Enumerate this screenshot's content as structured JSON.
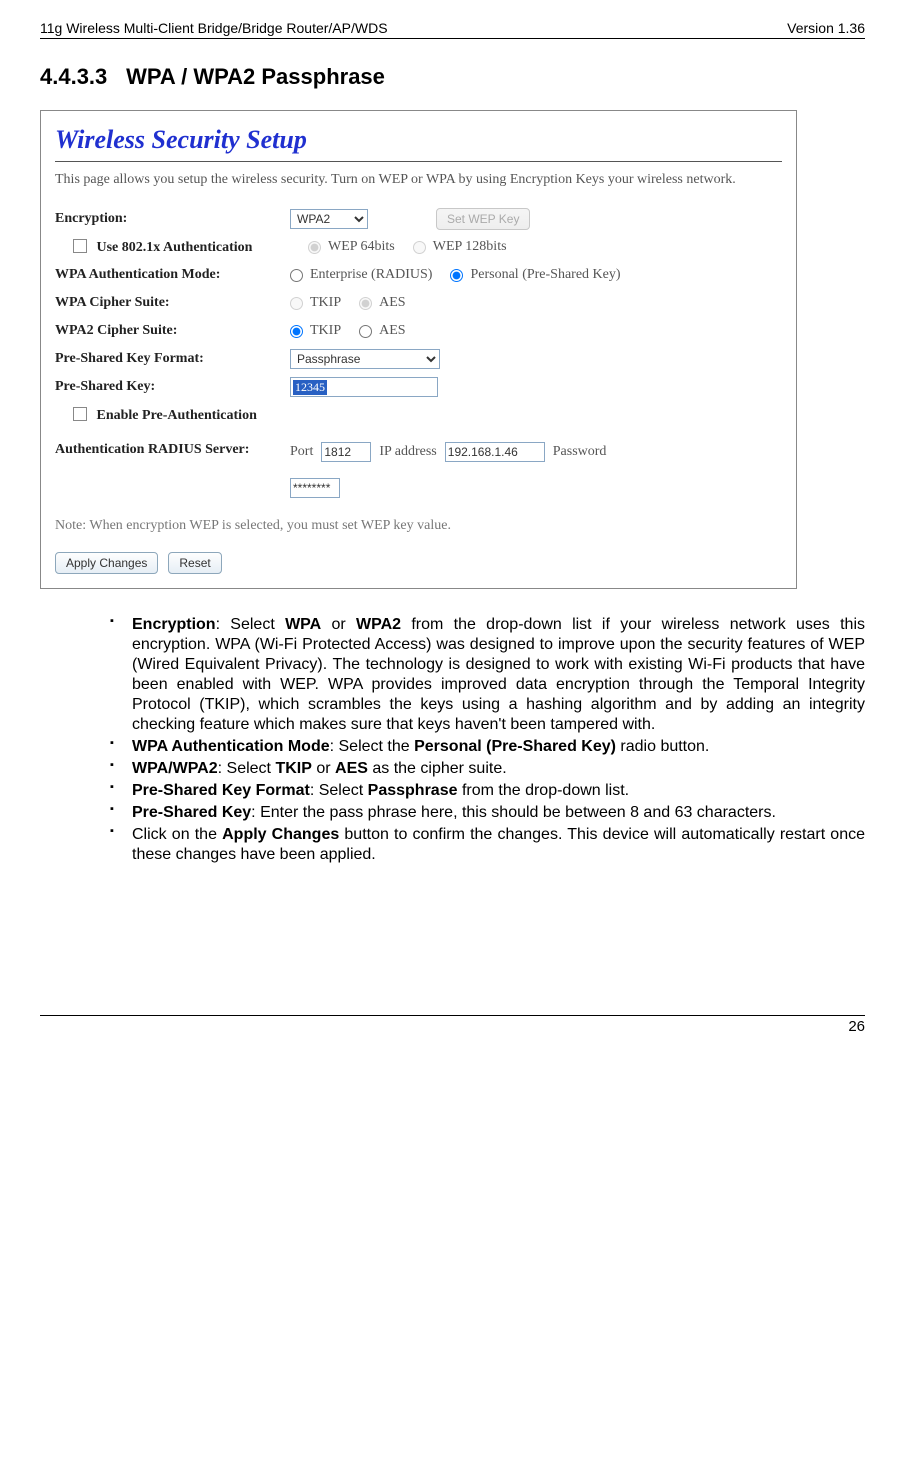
{
  "header": {
    "left": "11g Wireless Multi-Client Bridge/Bridge Router/AP/WDS",
    "right": "Version 1.36"
  },
  "title": {
    "num": "4.4.3.3",
    "text": "WPA / WPA2 Passphrase"
  },
  "ss": {
    "title": "Wireless Security Setup",
    "desc": "This page allows you setup the wireless security. Turn on WEP or WPA by using Encryption Keys your wireless network.",
    "labels": {
      "encryption": "Encryption:",
      "use8021x": "Use 802.1x Authentication",
      "wpaAuth": "WPA Authentication Mode:",
      "wpaCipher": "WPA Cipher Suite:",
      "wpa2Cipher": "WPA2 Cipher Suite:",
      "pskFormat": "Pre-Shared Key Format:",
      "psk": "Pre-Shared Key:",
      "enablePreAuth": "Enable Pre-Authentication",
      "radius": "Authentication RADIUS Server:"
    },
    "encryptionValue": "WPA2",
    "setWepBtn": "Set WEP Key",
    "wepOpts": {
      "a": "WEP 64bits",
      "b": "WEP 128bits"
    },
    "authOpts": {
      "a": "Enterprise (RADIUS)",
      "b": "Personal (Pre-Shared Key)"
    },
    "cipherOpts": {
      "tkip": "TKIP",
      "aes": "AES"
    },
    "pskFormatValue": "Passphrase",
    "pskValue": "12345",
    "radius": {
      "port": "Port",
      "portVal": "1812",
      "ip": "IP address",
      "ipVal": "192.168.1.46",
      "pwd": "Password",
      "pwdVal": "********"
    },
    "note": "Note: When encryption WEP is selected, you must set WEP key value.",
    "apply": "Apply Changes",
    "reset": "Reset"
  },
  "b": {
    "enc": {
      "lbl": "Encryption",
      "t1": ": Select ",
      "w1": "WPA",
      "t2": " or ",
      "w2": " WPA2",
      "t3": " from the drop-down list if your wireless network uses this encryption. WPA (Wi-Fi Protected Access) was designed to improve upon the security features of WEP (Wired Equivalent Privacy). The technology is designed to work with existing Wi-Fi products that have been enabled with WEP. WPA provides improved data encryption through the Temporal Integrity Protocol (TKIP), which scrambles the keys using a hashing algorithm and by adding an integrity checking feature which makes sure that keys haven't been tampered with."
    },
    "auth": {
      "lbl": "WPA Authentication Mode",
      "t1": ": Select the ",
      "v": "Personal (Pre-Shared Key)",
      "t2": " radio button."
    },
    "cip": {
      "lbl": "WPA/WPA2",
      "t1": ": Select ",
      "v1": "TKIP",
      "t2": " or ",
      "v2": "AES",
      "t3": " as the cipher suite."
    },
    "fmt": {
      "lbl": "Pre-Shared Key Format",
      "t1": ": Select ",
      "v": "Passphrase",
      "t2": " from the drop-down list."
    },
    "key": {
      "lbl": "Pre-Shared Key",
      "t": ": Enter the pass phrase here, this should be between 8 and 63 characters."
    },
    "apply": {
      "t1": "Click on the ",
      "v": "Apply Changes",
      "t2": " button to confirm the changes. This device will automatically restart once these changes have been applied."
    }
  },
  "footer": "26"
}
